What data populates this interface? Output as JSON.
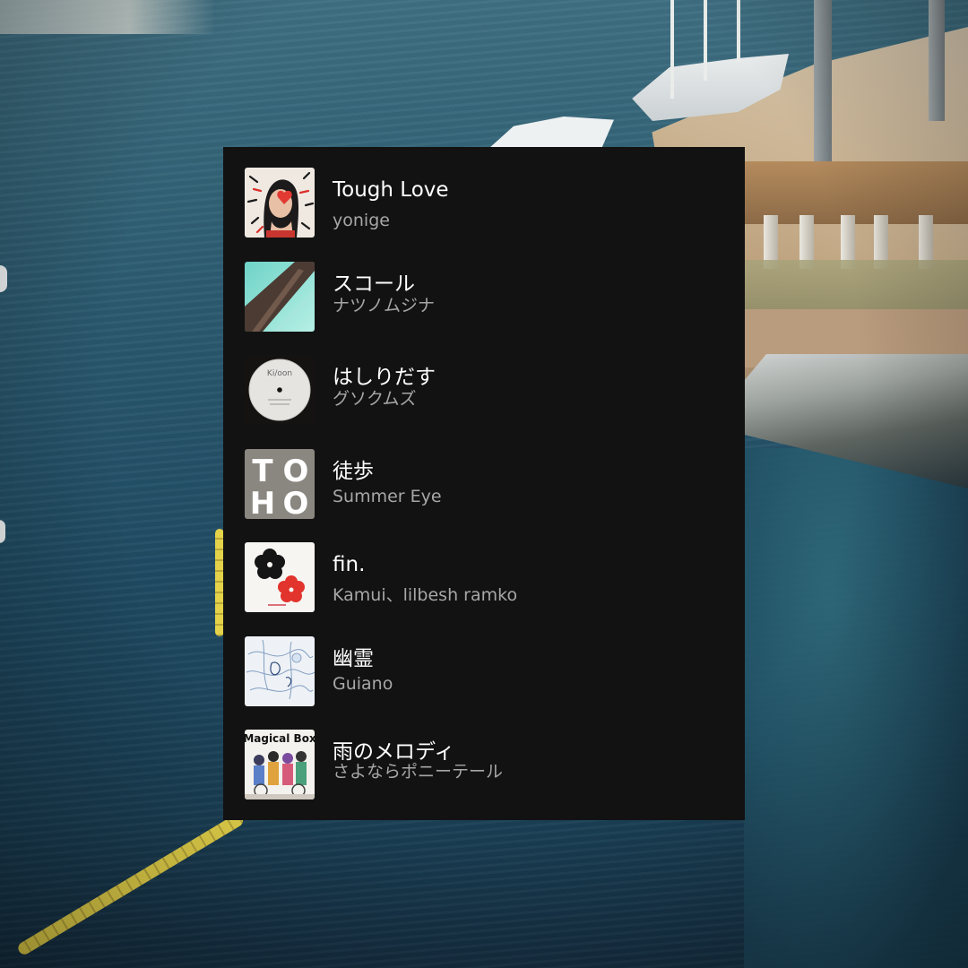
{
  "playlist": {
    "tracks": [
      {
        "title": "Tough Love",
        "artist": "yonige",
        "cover_icon": "woman-portrait-cover"
      },
      {
        "title": "スコール",
        "artist": "ナツノムジナ",
        "cover_icon": "aqua-abstract-cover"
      },
      {
        "title": "はしりだす",
        "artist": "グソクムズ",
        "cover_icon": "vinyl-record-cover",
        "cover_text": "Ki/oon"
      },
      {
        "title": "徒歩",
        "artist": "Summer Eye",
        "cover_icon": "block-letters-cover",
        "cover_text": [
          "T",
          "O",
          "H",
          "O"
        ]
      },
      {
        "title": "fin.",
        "artist": "Kamui、lilbesh ramko",
        "cover_icon": "flower-cover"
      },
      {
        "title": "幽霊",
        "artist": "Guiano",
        "cover_icon": "sketch-illustration-cover"
      },
      {
        "title": "雨のメロディ",
        "artist": "さよならポニーテール",
        "cover_icon": "anime-group-cover",
        "cover_text": "Magical Box"
      }
    ]
  },
  "colors": {
    "panel_bg": "#121212",
    "title": "#ffffff",
    "artist": "#a7a7a7"
  }
}
